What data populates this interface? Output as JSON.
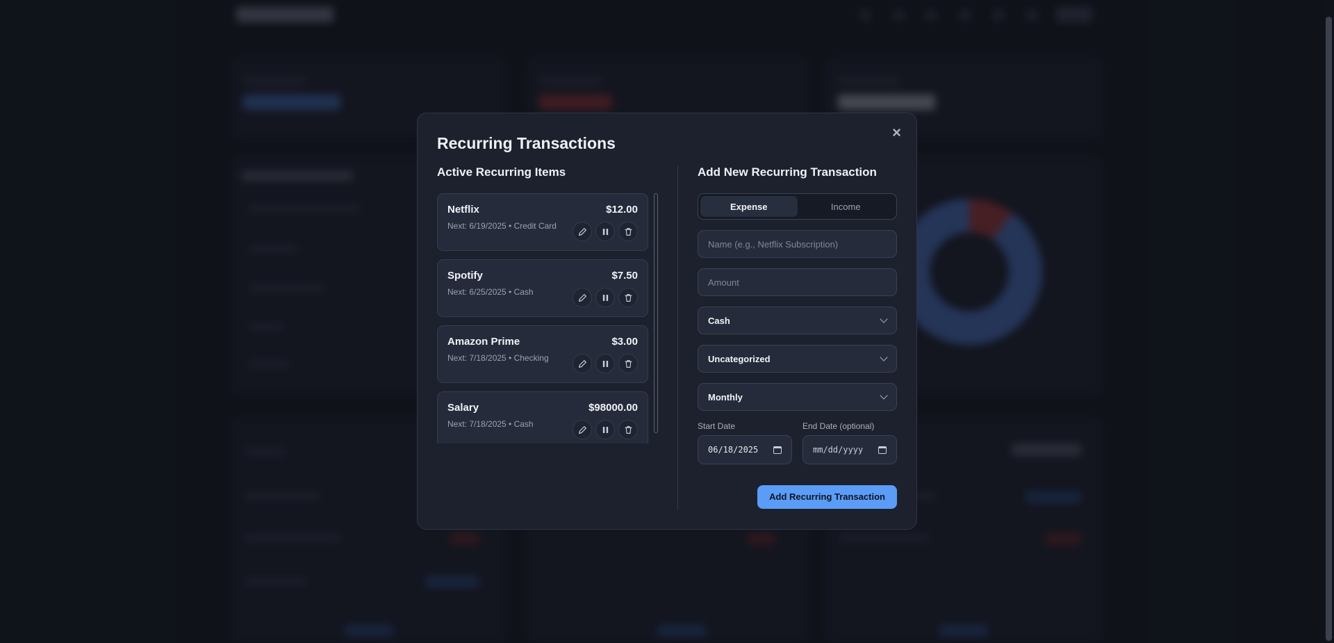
{
  "modal": {
    "title": "Recurring Transactions",
    "close_icon": "×"
  },
  "active": {
    "title": "Active Recurring Items",
    "items": [
      {
        "name": "Netflix",
        "amount": "$12.00",
        "meta": "Next: 6/19/2025 • Credit Card"
      },
      {
        "name": "Spotify",
        "amount": "$7.50",
        "meta": "Next: 6/25/2025 • Cash"
      },
      {
        "name": "Amazon Prime",
        "amount": "$3.00",
        "meta": "Next: 7/18/2025 • Checking"
      },
      {
        "name": "Salary",
        "amount": "$98000.00",
        "meta": "Next: 7/18/2025 • Cash"
      }
    ]
  },
  "form": {
    "title": "Add New Recurring Transaction",
    "type_expense": "Expense",
    "type_income": "Income",
    "selected_type": "Expense",
    "name_placeholder": "Name (e.g., Netflix Subscription)",
    "amount_placeholder": "Amount",
    "account": "Cash",
    "category": "Uncategorized",
    "frequency": "Monthly",
    "start_label": "Start Date",
    "start_value": "06/18/2025",
    "end_label": "End Date (optional)",
    "end_value": "mm/dd/yyyy",
    "submit_label": "Add Recurring Transaction"
  },
  "colors": {
    "accent": "#5b9cf6",
    "modal_bg": "#1c212d",
    "page_bg": "#141821"
  }
}
